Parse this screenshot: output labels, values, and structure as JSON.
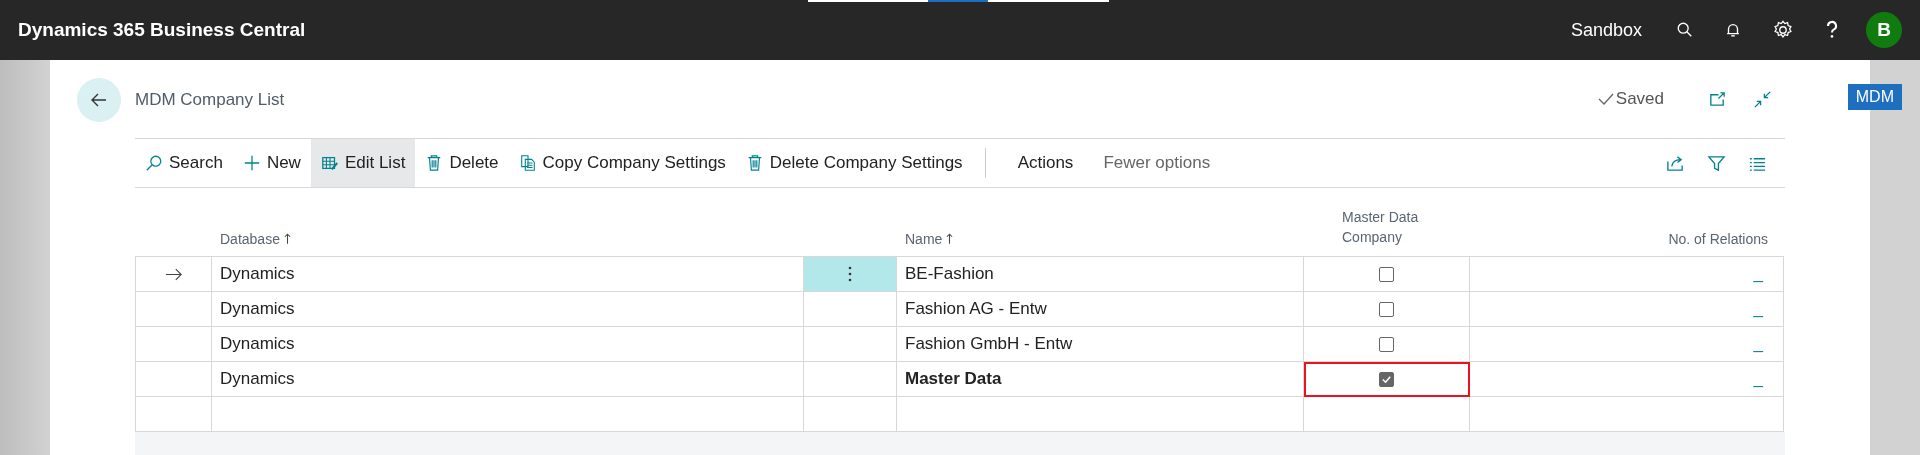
{
  "app_bar": {
    "title": "Dynamics 365 Business Central",
    "environment": "Sandbox",
    "avatar": "B"
  },
  "side_badge": "MDM",
  "page": {
    "title": "MDM Company List",
    "status": "Saved"
  },
  "actions": [
    {
      "kind": "search",
      "label": "Search",
      "selected": false
    },
    {
      "kind": "new",
      "label": "New",
      "selected": false
    },
    {
      "kind": "edit",
      "label": "Edit List",
      "selected": true
    },
    {
      "kind": "delete",
      "label": "Delete",
      "selected": false
    },
    {
      "kind": "copy",
      "label": "Copy Company Settings",
      "selected": false
    },
    {
      "kind": "delete",
      "label": "Delete Company Settings",
      "selected": false
    },
    {
      "kind": "separator"
    },
    {
      "kind": "text",
      "label": "Actions",
      "selected": false
    },
    {
      "kind": "muted",
      "label": "Fewer options",
      "selected": false
    }
  ],
  "table": {
    "columns": [
      {
        "label": "Database",
        "sorted": true
      },
      {
        "label": "Name",
        "sorted": true
      },
      {
        "label": "Master Data Company",
        "sorted": false
      },
      {
        "label": "No. of Relations",
        "sorted": false
      }
    ],
    "rows": [
      {
        "selected": true,
        "database": "Dynamics",
        "name": "BE-Fashion",
        "emphasized": false,
        "master_data_company": false,
        "highlighted": false,
        "relations": "_"
      },
      {
        "selected": false,
        "database": "Dynamics",
        "name": "Fashion AG - Entw",
        "emphasized": false,
        "master_data_company": false,
        "highlighted": false,
        "relations": "_"
      },
      {
        "selected": false,
        "database": "Dynamics",
        "name": "Fashion GmbH - Entw",
        "emphasized": false,
        "master_data_company": false,
        "highlighted": false,
        "relations": "_"
      },
      {
        "selected": false,
        "database": "Dynamics",
        "name": "Master Data",
        "emphasized": true,
        "master_data_company": true,
        "highlighted": true,
        "relations": "_"
      }
    ]
  }
}
